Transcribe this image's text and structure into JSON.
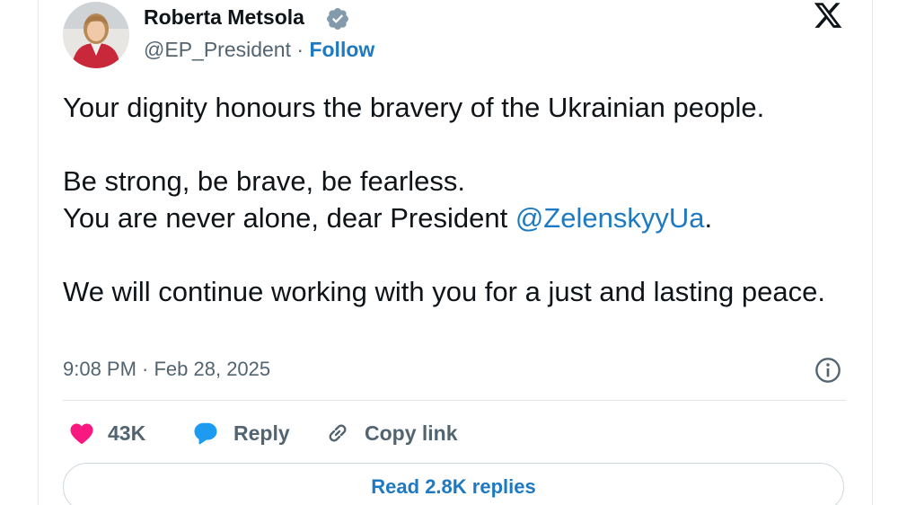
{
  "author": {
    "name": "Roberta Metsola",
    "handle": "@EP_President",
    "separator": " · ",
    "follow_label": "Follow"
  },
  "tweet": {
    "line1": "Your dignity honours the bravery of the Ukrainian people.",
    "line2": "Be strong, be brave, be fearless.",
    "line3_prefix": "You are never alone, dear President ",
    "mention": "@ZelenskyyUa",
    "line3_suffix": ".",
    "line4": "We will continue working with you for a just and lasting peace."
  },
  "timestamp": "9:08 PM · Feb 28, 2025",
  "actions": {
    "like_count": "43K",
    "reply_label": "Reply",
    "copy_label": "Copy link"
  },
  "read_replies_label": "Read 2.8K replies",
  "colors": {
    "link": "#1d7ac2",
    "like": "#f91880",
    "reply": "#1d9bf0",
    "muted": "#536471"
  },
  "icons": [
    "verified-badge-icon",
    "x-logo-icon",
    "info-icon",
    "heart-icon",
    "reply-bubble-icon",
    "link-icon"
  ]
}
